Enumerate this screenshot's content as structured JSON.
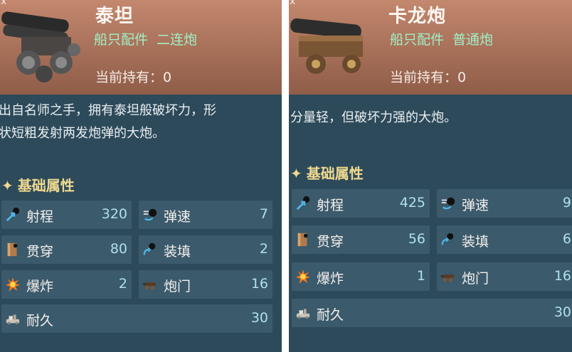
{
  "cards": [
    {
      "close_label": "x",
      "name": "泰坦",
      "type_main": "船只配件",
      "type_sub": "二连炮",
      "owned_label": "当前持有：",
      "owned_value": "0",
      "description": "出自名师之手，拥有泰坦般破坏力，形\n状短粗发射两发炮弹的大炮。",
      "section_title": "基础属性",
      "stats": {
        "range": {
          "label": "射程",
          "value": "320"
        },
        "speed": {
          "label": "弹速",
          "value": "7"
        },
        "pierce": {
          "label": "贯穿",
          "value": "80"
        },
        "reload": {
          "label": "装填",
          "value": "2"
        },
        "explode": {
          "label": "爆炸",
          "value": "2"
        },
        "ports": {
          "label": "炮门",
          "value": "16"
        },
        "durability": {
          "label": "耐久",
          "value": "30"
        }
      }
    },
    {
      "close_label": "x",
      "name": "卡龙炮",
      "type_main": "船只配件",
      "type_sub": "普通炮",
      "owned_label": "当前持有：",
      "owned_value": "0",
      "description": "分量轻，但破坏力强的大炮。",
      "section_title": "基础属性",
      "stats": {
        "range": {
          "label": "射程",
          "value": "425"
        },
        "speed": {
          "label": "弹速",
          "value": "9"
        },
        "pierce": {
          "label": "贯穿",
          "value": "56"
        },
        "reload": {
          "label": "装填",
          "value": "6"
        },
        "explode": {
          "label": "爆炸",
          "value": "1"
        },
        "ports": {
          "label": "炮门",
          "value": "16"
        },
        "durability": {
          "label": "耐久",
          "value": "30"
        }
      }
    }
  ],
  "icons": {
    "range": "range-arrow-icon",
    "speed": "bullet-speed-icon",
    "pierce": "pierce-plank-icon",
    "reload": "reload-icon",
    "explode": "explosion-icon",
    "ports": "cannon-port-icon",
    "durability": "durability-icon"
  },
  "colors": {
    "header": "#a66f58",
    "panel": "#2d4a5a",
    "stat_bg": "#3b5a6b",
    "type_text": "#9ff0c6",
    "section_title": "#f0d98f",
    "stat_value": "#aee1ea"
  }
}
